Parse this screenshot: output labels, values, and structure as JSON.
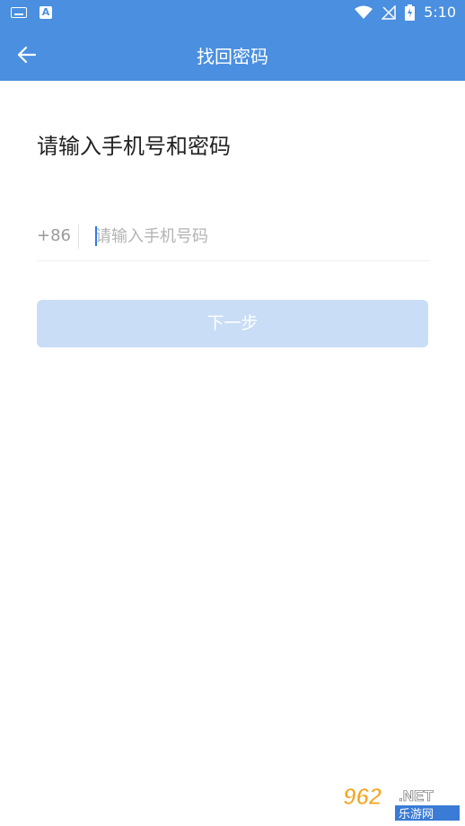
{
  "status_bar": {
    "time": "5:10",
    "icons": [
      "keyboard-icon",
      "a-app-icon",
      "wifi-icon",
      "no-signal-icon",
      "battery-charging-icon"
    ]
  },
  "app_bar": {
    "title": "找回密码",
    "back_icon": "arrow-left-icon"
  },
  "main": {
    "heading": "请输入手机号和密码",
    "country_code": "+86",
    "phone_placeholder": "请输入手机号码",
    "phone_value": "",
    "next_label": "下一步"
  },
  "watermark": {
    "text": "962.NET",
    "subtext": "乐游网"
  },
  "colors": {
    "brand": "#4a8fe0",
    "button_disabled": "#c9ddf6",
    "caret": "#2c7be5"
  }
}
